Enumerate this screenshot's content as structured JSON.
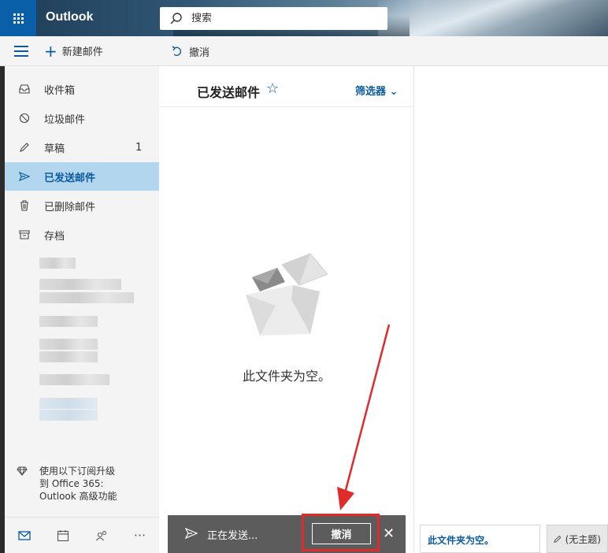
{
  "header": {
    "app_name": "Outlook",
    "search_placeholder": "搜索"
  },
  "command_bar": {
    "new_mail": "新建邮件",
    "undo": "撤消"
  },
  "nav": {
    "items": [
      {
        "label": "收件箱",
        "count": "",
        "icon": "inbox-icon"
      },
      {
        "label": "垃圾邮件",
        "count": "",
        "icon": "junk-icon"
      },
      {
        "label": "草稿",
        "count": "1",
        "icon": "pencil-icon"
      },
      {
        "label": "已发送邮件",
        "count": "",
        "icon": "send-icon",
        "selected": true
      },
      {
        "label": "已删除邮件",
        "count": "",
        "icon": "trash-icon"
      },
      {
        "label": "存档",
        "count": "",
        "icon": "archive-icon"
      }
    ],
    "upgrade_text_line1": "使用以下订阅升级",
    "upgrade_text_line2": "到 Office 365:",
    "upgrade_text_line3": "Outlook 高级功能"
  },
  "list": {
    "folder_title": "已发送邮件",
    "filter": "筛选器",
    "empty_message": "此文件夹为空。"
  },
  "toast": {
    "status": "正在发送...",
    "undo_button": "撤消"
  },
  "drafts": {
    "tab1": "此文件夹为空。",
    "tab2": "(无主题)"
  },
  "colors": {
    "accent": "#0a5a9c",
    "selected_bg": "#b3d6ef",
    "toast_bg": "#5c5c5c",
    "highlight": "#e02b2b"
  }
}
